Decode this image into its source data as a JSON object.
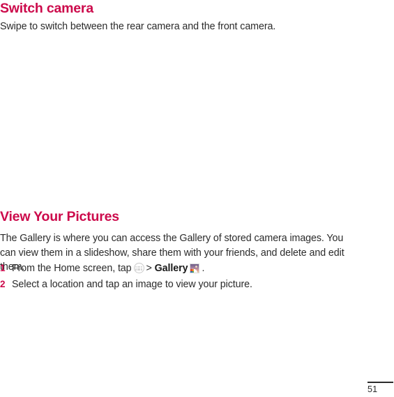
{
  "page": {
    "number": "51",
    "accent_color": "#cc0a4b",
    "text_color": "#2b2b2b"
  },
  "sections": [
    {
      "heading": "Switch camera",
      "paragraph": "Swipe to switch between the rear camera and the front camera."
    },
    {
      "heading": "View Your Pictures",
      "paragraph": "The Gallery is where you can access the Gallery of stored camera images. You can view them in a slideshow, share them with your friends, and delete and edit them."
    }
  ],
  "steps": [
    {
      "number": "1",
      "text_before_icon": "From the Home screen, tap",
      "apps_icon": "apps-grid-icon",
      "separator": ">",
      "bold_label": "Gallery",
      "gallery_icon": "gallery-photo-icon",
      "text_after_icon": "."
    },
    {
      "number": "2",
      "text": "Select a location and tap an image to view your picture."
    }
  ]
}
